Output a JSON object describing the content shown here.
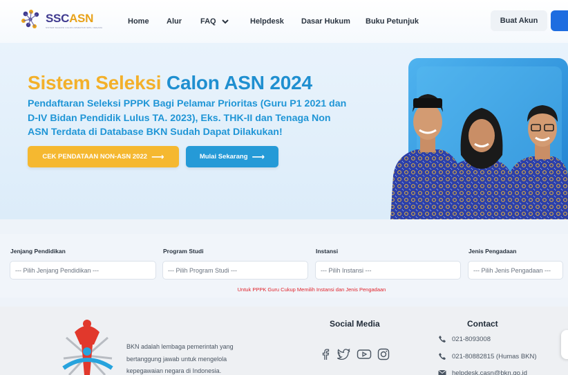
{
  "nav": {
    "logo_text_1": "SSC",
    "logo_text_2": "ASN",
    "logo_sub": "SISTEM SELEKSI CALON APARATUR SIPIL NEGARA",
    "items": [
      "Home",
      "Alur",
      "FAQ",
      "Helpdesk",
      "Dasar Hukum",
      "Buku Petunjuk"
    ],
    "register_label": "Buat Akun"
  },
  "hero": {
    "title_part1": "Sistem Seleksi",
    "title_part2": "Calon ASN 2024",
    "description": "Pendaftaran Seleksi PPPK Bagi Pelamar Prioritas (Guru P1 2021 dan D-IV Bidan Pendidik Lulus TA. 2023), Eks. THK-II dan Tenaga Non ASN Terdata di Database BKN Sudah Dapat Dilakukan!",
    "btn_check": "CEK PENDATAAN NON-ASN 2022",
    "btn_start": "Mulai Sekarang"
  },
  "filter": {
    "fields": [
      {
        "label": "Jenjang Pendidikan",
        "placeholder": "--- Pilih Jenjang Pendidikan ---"
      },
      {
        "label": "Program Studi",
        "placeholder": "--- Pilih Program Studi ---"
      },
      {
        "label": "Instansi",
        "placeholder": "--- Pilih Instansi ---"
      },
      {
        "label": "Jenis Pengadaan",
        "placeholder": "--- Pilih Jenis Pengadaan ---"
      }
    ],
    "note": "Untuk PPPK Guru Cukup Memilih Instansi dan Jenis Pengadaan"
  },
  "footer": {
    "about": "BKN adalah lembaga pemerintah yang bertanggung jawab untuk mengelola kepegawaian negara di Indonesia.",
    "social_heading": "Social Media",
    "contact_heading": "Contact",
    "contacts": [
      "021-8093008",
      "021-80882815 (Humas BKN)",
      "helpdesk.casn@bkn.go.id"
    ]
  },
  "colors": {
    "accent_yellow": "#f3b02a",
    "accent_blue": "#1f8fd0",
    "primary_button": "#1e6de0",
    "note_red": "#e0232b"
  }
}
